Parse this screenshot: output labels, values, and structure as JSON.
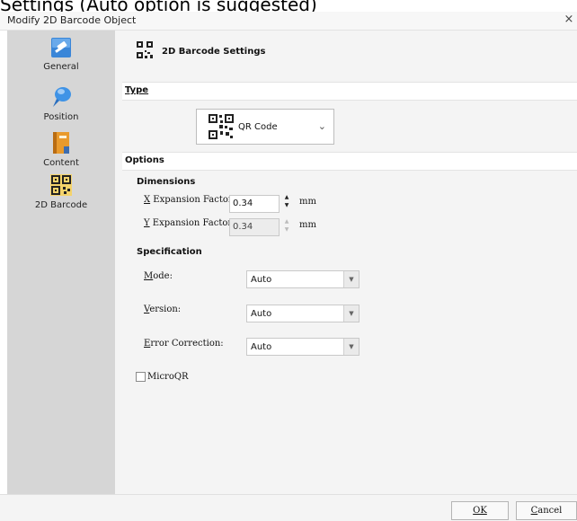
{
  "caption": "Settings (Auto option is suggested)",
  "window": {
    "title": "Modify 2D Barcode Object",
    "close_glyph": "×"
  },
  "sidebar": {
    "items": [
      {
        "label": "General",
        "icon": "general-icon"
      },
      {
        "label": "Position",
        "icon": "position-pin-icon"
      },
      {
        "label": "Content",
        "icon": "content-book-icon"
      },
      {
        "label": "2D Barcode",
        "icon": "qr-code-icon",
        "selected": true
      }
    ]
  },
  "header": {
    "title": "2D Barcode Settings",
    "icon": "qr-code-icon"
  },
  "type_section": {
    "title": "Type",
    "title_underlined_char": "T",
    "selected": "QR Code",
    "icon": "qr-code-icon"
  },
  "options": {
    "title": "Options",
    "dimensions": {
      "heading": "Dimensions",
      "x_label_accel": "X",
      "x_label_rest": " Expansion Factor:",
      "x_value": "0.34",
      "y_label_accel": "Y",
      "y_label_rest": " Expansion Factor:",
      "y_value": "0.34",
      "unit": "mm"
    },
    "specification": {
      "heading": "Specification",
      "mode_accel": "M",
      "mode_rest": "ode:",
      "mode_value": "Auto",
      "version_accel": "V",
      "version_rest": "ersion:",
      "version_value": "Auto",
      "ec_accel": "E",
      "ec_rest": "rror Correction:",
      "ec_value": "Auto",
      "microqr_label": "MicroQR",
      "microqr_checked": false
    }
  },
  "footer": {
    "ok_label": "OK",
    "ok_accel": "O",
    "cancel_label": "Cancel",
    "cancel_accel": "C"
  },
  "colors": {
    "sidebar_bg": "#d6d6d6",
    "content_bg": "#f4f4f4",
    "accent_blue": "#2e7dd6"
  }
}
